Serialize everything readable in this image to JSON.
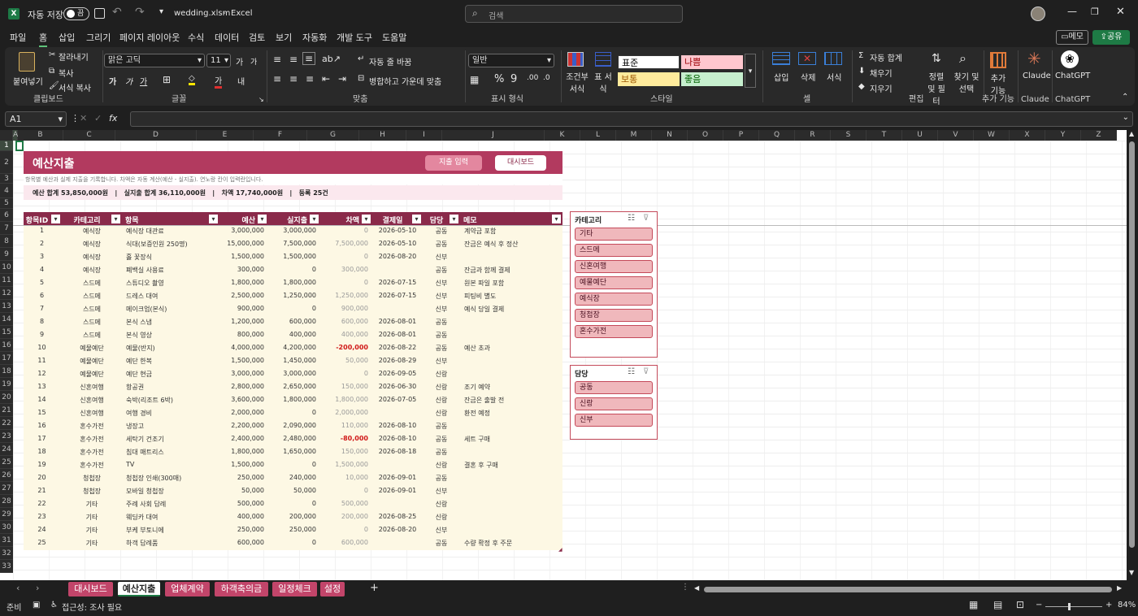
{
  "titlebar": {
    "autosave": "자동 저장",
    "toggle": "끔",
    "filename": "wedding.xlsm",
    "sep": "-",
    "app": "Excel",
    "search_placeholder": "검색"
  },
  "ribbon_tabs": [
    "파일",
    "홈",
    "삽입",
    "그리기",
    "페이지 레이아웃",
    "수식",
    "데이터",
    "검토",
    "보기",
    "자동화",
    "개발 도구",
    "도움말"
  ],
  "comment_btn": "메모",
  "share_btn": "공유",
  "ribbon": {
    "clipboard": {
      "paste": "붙여넣기",
      "cut": "잘라내기",
      "copy": "복사",
      "format_painter": "서식 복사",
      "label": "클립보드"
    },
    "font": {
      "name": "맑은 고딕",
      "size": "11",
      "grow": "가",
      "shrink": "가",
      "bold": "가",
      "italic": "가",
      "underline": "가",
      "fontcolor": "가",
      "phonetic": "내",
      "label": "글꼴"
    },
    "align": {
      "wrap": "자동 줄 바꿈",
      "merge": "병합하고 가운데 맞춤",
      "label": "맞춤"
    },
    "number": {
      "format": "일반",
      "label": "표시 형식"
    },
    "styles": {
      "cond": "조건부 서식",
      "table": "표 서식",
      "normal": "표준",
      "bad": "나쁨",
      "neutral": "보통",
      "good": "좋음",
      "label": "스타일"
    },
    "cells": {
      "insert": "삽입",
      "delete": "삭제",
      "format": "서식",
      "label": "셀"
    },
    "editing": {
      "autosum": "자동 합계",
      "fill": "채우기",
      "clear": "지우기",
      "sort": "정렬 및 필터",
      "find": "찾기 및 선택",
      "label": "편집"
    },
    "addins": {
      "btn": "추가 기능",
      "label": "추가 기능"
    },
    "claude": {
      "btn": "Claude",
      "label": "Claude"
    },
    "chatgpt": {
      "btn": "ChatGPT",
      "label": "ChatGPT"
    }
  },
  "formula_bar": {
    "namebox": "A1",
    "fx": "fx",
    "value": ""
  },
  "columns": [
    "A",
    "B",
    "C",
    "D",
    "E",
    "F",
    "G",
    "H",
    "I",
    "J",
    "K",
    "L",
    "M",
    "N",
    "O",
    "P",
    "Q",
    "R",
    "S",
    "T",
    "U",
    "V",
    "W",
    "X",
    "Y",
    "Z"
  ],
  "rows": [
    "1",
    "2",
    "3",
    "4",
    "5",
    "6",
    "7",
    "8",
    "9",
    "10",
    "11",
    "12",
    "13",
    "14",
    "15",
    "16",
    "17",
    "18",
    "19",
    "20",
    "21",
    "22",
    "23",
    "24",
    "25",
    "26",
    "27",
    "28",
    "29",
    "30",
    "31",
    "32",
    "33"
  ],
  "sheet": {
    "title": "예산지출",
    "btn_input": "지출 입력",
    "btn_dashboard": "대시보드",
    "subtitle": "항목별 예산과 실제 지출을 기록합니다. 차액은 자동 계산(예산 - 실지출). 연노랑 칸이 입력란입니다.",
    "summary": "예산 합계 53,850,000원   |   실지출 합계 36,110,000원   |   차액 17,740,000원   |   등록 25건",
    "headers": [
      "항목ID",
      "카테고리",
      "항목",
      "예산",
      "실지출",
      "차액",
      "결제일",
      "담당",
      "메모"
    ],
    "rows": [
      [
        "1",
        "예식장",
        "예식장 대관료",
        "3,000,000",
        "3,000,000",
        "0",
        "2026-05-10",
        "공동",
        "계약금 포함"
      ],
      [
        "2",
        "예식장",
        "식대(보증인원 250명)",
        "15,000,000",
        "7,500,000",
        "7,500,000",
        "2026-05-10",
        "공동",
        "잔금은 예식 후 정산"
      ],
      [
        "3",
        "예식장",
        "홀 꽃장식",
        "1,500,000",
        "1,500,000",
        "0",
        "2026-08-20",
        "신부",
        ""
      ],
      [
        "4",
        "예식장",
        "폐백실 사용료",
        "300,000",
        "0",
        "300,000",
        "",
        "공동",
        "잔금과 함께 결제"
      ],
      [
        "5",
        "스드메",
        "스튜디오 촬영",
        "1,800,000",
        "1,800,000",
        "0",
        "2026-07-15",
        "신부",
        "원본 파일 포함"
      ],
      [
        "6",
        "스드메",
        "드레스 대여",
        "2,500,000",
        "1,250,000",
        "1,250,000",
        "2026-07-15",
        "신부",
        "피팅비 별도"
      ],
      [
        "7",
        "스드메",
        "메이크업(본식)",
        "900,000",
        "0",
        "900,000",
        "",
        "신부",
        "예식 당일 결제"
      ],
      [
        "8",
        "스드메",
        "본식 스냅",
        "1,200,000",
        "600,000",
        "600,000",
        "2026-08-01",
        "공동",
        ""
      ],
      [
        "9",
        "스드메",
        "본식 영상",
        "800,000",
        "400,000",
        "400,000",
        "2026-08-01",
        "공동",
        ""
      ],
      [
        "10",
        "예물예단",
        "예물(반지)",
        "4,000,000",
        "4,200,000",
        "-200,000",
        "2026-08-22",
        "공동",
        "예산 초과"
      ],
      [
        "11",
        "예물예단",
        "예단 한복",
        "1,500,000",
        "1,450,000",
        "50,000",
        "2026-08-29",
        "신부",
        ""
      ],
      [
        "12",
        "예물예단",
        "예단 현금",
        "3,000,000",
        "3,000,000",
        "0",
        "2026-09-05",
        "신랑",
        ""
      ],
      [
        "13",
        "신혼여행",
        "항공권",
        "2,800,000",
        "2,650,000",
        "150,000",
        "2026-06-30",
        "신랑",
        "조기 예약"
      ],
      [
        "14",
        "신혼여행",
        "숙박(리조트 6박)",
        "3,600,000",
        "1,800,000",
        "1,800,000",
        "2026-07-05",
        "신랑",
        "잔금은 출발 전"
      ],
      [
        "15",
        "신혼여행",
        "여행 경비",
        "2,000,000",
        "0",
        "2,000,000",
        "",
        "신랑",
        "환전 예정"
      ],
      [
        "16",
        "혼수가전",
        "냉장고",
        "2,200,000",
        "2,090,000",
        "110,000",
        "2026-08-10",
        "공동",
        ""
      ],
      [
        "17",
        "혼수가전",
        "세탁기 건조기",
        "2,400,000",
        "2,480,000",
        "-80,000",
        "2026-08-10",
        "공동",
        "세트 구매"
      ],
      [
        "18",
        "혼수가전",
        "침대 매트리스",
        "1,800,000",
        "1,650,000",
        "150,000",
        "2026-08-18",
        "공동",
        ""
      ],
      [
        "19",
        "혼수가전",
        "TV",
        "1,500,000",
        "0",
        "1,500,000",
        "",
        "신랑",
        "결혼 후 구매"
      ],
      [
        "20",
        "청첩장",
        "청첩장 인쇄(300매)",
        "250,000",
        "240,000",
        "10,000",
        "2026-09-01",
        "공동",
        ""
      ],
      [
        "21",
        "청첩장",
        "모바일 청첩장",
        "50,000",
        "50,000",
        "0",
        "2026-09-01",
        "신부",
        ""
      ],
      [
        "22",
        "기타",
        "주례 사회 답례",
        "500,000",
        "0",
        "500,000",
        "",
        "신랑",
        ""
      ],
      [
        "23",
        "기타",
        "웨딩카 대여",
        "400,000",
        "200,000",
        "200,000",
        "2026-08-25",
        "신랑",
        ""
      ],
      [
        "24",
        "기타",
        "부케 부토니에",
        "250,000",
        "250,000",
        "0",
        "2026-08-20",
        "신부",
        ""
      ],
      [
        "25",
        "기타",
        "하객 답례품",
        "600,000",
        "0",
        "600,000",
        "",
        "공동",
        "수량 확정 후 주문"
      ]
    ]
  },
  "slicer_category": {
    "title": "카테고리",
    "items": [
      "기타",
      "스드메",
      "신혼여행",
      "예물예단",
      "예식장",
      "청첩장",
      "혼수가전"
    ]
  },
  "slicer_owner": {
    "title": "담당",
    "items": [
      "공동",
      "신랑",
      "신부"
    ]
  },
  "sheet_tabs": [
    "대시보드",
    "예산지출",
    "업체계약",
    "하객축의금",
    "일정체크",
    "설정"
  ],
  "active_tab": "예산지출",
  "statusbar": {
    "ready": "준비",
    "accessibility": "접근성: 조사 필요",
    "zoom": "84%"
  },
  "colors": {
    "title_band": "#b23a5f",
    "header_row": "#8a2a4a",
    "input_fill": "#fdf8e4",
    "slicer_item": "#f0b8bc",
    "tab": "#c2456a"
  }
}
